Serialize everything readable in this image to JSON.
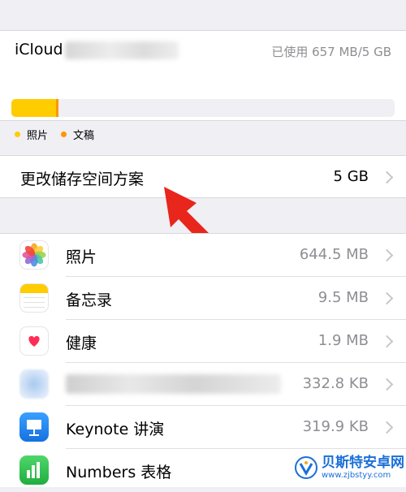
{
  "icloud": {
    "title": "iCloud",
    "usage_text": "已使用 657 MB/5 GB",
    "photos_fraction": 0.117,
    "docs_fraction": 0.006,
    "legend": [
      {
        "label": "照片",
        "color": "#ffcc00"
      },
      {
        "label": "文稿",
        "color": "#ff9500"
      }
    ]
  },
  "plan": {
    "label": "更改储存空间方案",
    "value": "5 GB"
  },
  "apps": [
    {
      "name": "照片",
      "size": "644.5 MB",
      "icon": "photos-icon"
    },
    {
      "name": "备忘录",
      "size": "9.5 MB",
      "icon": "notes-icon"
    },
    {
      "name": "健康",
      "size": "1.9 MB",
      "icon": "health-icon"
    },
    {
      "name": "",
      "size": "332.8 KB",
      "icon": "blurred-app-icon"
    },
    {
      "name": "Keynote 讲演",
      "size": "319.9 KB",
      "icon": "keynote-icon"
    },
    {
      "name": "Numbers 表格",
      "size": "",
      "icon": "numbers-icon"
    }
  ],
  "watermark": {
    "main": "贝斯特安卓网",
    "sub": "www.zjbstyy.com"
  },
  "colors": {
    "photos_bar": "#ffcc00",
    "docs_bar": "#ff9500",
    "arrow": "#e8261c",
    "keynote": "#1d8af0",
    "numbers": "#2ec24e"
  }
}
